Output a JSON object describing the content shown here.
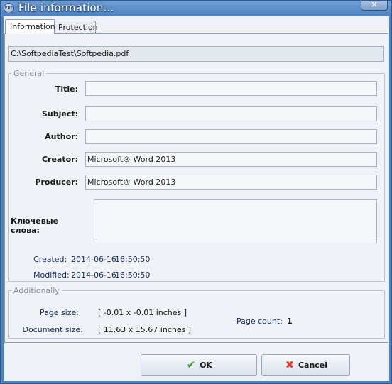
{
  "window": {
    "title": "File information...",
    "close_glyph": "✕",
    "icon_label": "PDF"
  },
  "tabs": [
    {
      "label": "Information",
      "active": true
    },
    {
      "label": "Protection",
      "active": false
    }
  ],
  "file_path": "C:\\SoftpediaTest\\Softpedia.pdf",
  "general": {
    "legend": "General",
    "fields": {
      "title": {
        "label": "Title:",
        "value": ""
      },
      "subject": {
        "label": "Subject:",
        "value": ""
      },
      "author": {
        "label": "Author:",
        "value": ""
      },
      "creator": {
        "label": "Creator:",
        "value": "Microsoft® Word 2013"
      },
      "producer": {
        "label": "Producer:",
        "value": "Microsoft® Word 2013"
      },
      "keywords": {
        "label": "Ключевые слова:",
        "value": ""
      }
    },
    "created": {
      "label": "Created:",
      "date": "2014-06-16",
      "time": "16:50:50"
    },
    "modified": {
      "label": "Modified:",
      "date": "2014-06-16",
      "time": "16:50:50"
    }
  },
  "additionally": {
    "legend": "Additionally",
    "page_size": {
      "label": "Page size:",
      "value": "[ -0.01 x -0.01 inches ]"
    },
    "document_size": {
      "label": "Document size:",
      "value": "[ 11.63 x 15.67 inches ]"
    },
    "page_count": {
      "label": "Page count:",
      "value": "1"
    }
  },
  "buttons": {
    "ok": {
      "label": "OK",
      "icon": "checkmark-icon"
    },
    "cancel": {
      "label": "Cancel",
      "icon": "x-icon"
    }
  },
  "colors": {
    "titlebar": "#4f82c0",
    "link_text": "#1b2f63",
    "ok_icon": "#3ea532",
    "cancel_icon": "#d9412f"
  }
}
